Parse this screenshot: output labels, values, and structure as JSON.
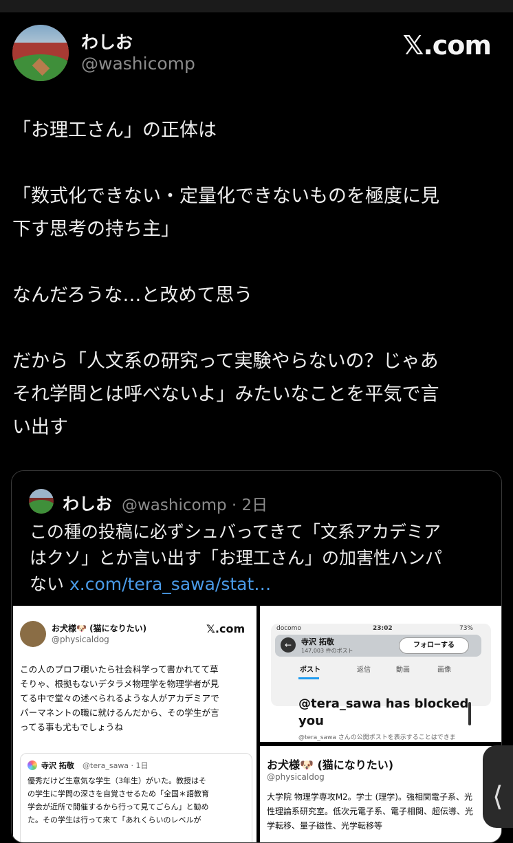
{
  "author": {
    "name": "わしお",
    "handle": "@washicomp"
  },
  "brand": "𝕏.com",
  "post": {
    "paragraphs": [
      "「お理工さん」の正体は",
      "「数式化できない・定量化できないものを極度に見\n下す思考の持ち主」",
      "なんだろうな…と改めて思う",
      "だから「人文系の研究って実験やらないの？じゃあ\nそれ学問とは呼べないよ」みたいなことを平気で言\nい出す"
    ]
  },
  "quote": {
    "name": "わしお",
    "handle": "@washicomp · 2日",
    "text": "この種の投稿に必ずシュバってきて「文系アカデミア\nはクソ」とか言い出す「お理工さん」の加害性ハンパ\nない ",
    "link": "x.com/tera_sawa/stat…"
  },
  "image1": {
    "name": "お犬様🐶 (猫になりたい)",
    "handle": "@physicaldog",
    "brand": "𝕏.com",
    "lines": [
      "この人のプロフ覗いたら社会科学って書かれてて草",
      "そりゃ、根拠もないデタラメ物理学を物理学者が見",
      "てる中で堂々の述べられるような人がアカデミアで",
      "パーマネントの職に就けるんだから、その学生が言",
      "ってる事も尤もでしょうね"
    ],
    "quote_name": "寺沢 拓敬",
    "quote_handle": "@tera_sawa · 1日",
    "quote_lines": [
      "優秀だけど生意気な学生（3年生）がいた。教授はそ",
      "の学生に学問の深さを自覚させるため「全国＊語教育",
      "学会が近所で開催するから行って見てごらん」と勧め",
      "た。その学生は行って来て「あれくらいのレベルが"
    ]
  },
  "image2": {
    "carrier": "docomo",
    "time": "23:02",
    "battery": "73%",
    "profile_name": "寺沢 拓敬",
    "post_count": "147,003 件のポスト",
    "follow_label": "フォローする",
    "tabs": [
      "ポスト",
      "返信",
      "動画",
      "画像"
    ],
    "blocked_text": "@tera_sawa has blocked you",
    "blocked_sub": "@tera_sawa さんの公開ポストを表示することはできま"
  },
  "image3": {
    "name": "お犬様🐶 (猫になりたい)",
    "handle": "@physicaldog",
    "lines": [
      "大学院 物理学専攻M2。学士 (理学)。強相関電子系、光",
      "性理論系研究室。低次元電子系、電子相関、超伝導、光",
      "学転移、量子磁性、光学転移等"
    ]
  },
  "scroll_glyph": "⟨"
}
